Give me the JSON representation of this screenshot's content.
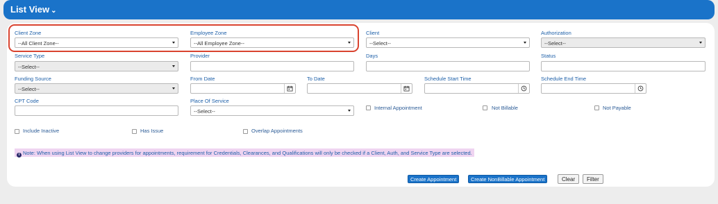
{
  "header": {
    "title": "List View"
  },
  "filters": {
    "client_zone": {
      "label": "Client Zone",
      "value": "--All Client Zone--"
    },
    "employee_zone": {
      "label": "Employee Zone",
      "value": "--All Employee Zone--"
    },
    "client": {
      "label": "Client",
      "value": "--Select--"
    },
    "authorization": {
      "label": "Authorization",
      "value": "--Select--"
    },
    "service_type": {
      "label": "Service Type",
      "value": "--Select--"
    },
    "provider": {
      "label": "Provider",
      "value": ""
    },
    "days": {
      "label": "Days",
      "value": ""
    },
    "status": {
      "label": "Status",
      "value": ""
    },
    "funding_source": {
      "label": "Funding Source",
      "value": "--Select--"
    },
    "from_date": {
      "label": "From Date",
      "value": ""
    },
    "to_date": {
      "label": "To Date",
      "value": ""
    },
    "schedule_start_time": {
      "label": "Schedule Start Time",
      "value": ""
    },
    "schedule_end_time": {
      "label": "Schedule End Time",
      "value": ""
    },
    "cpt_code": {
      "label": "CPT Code",
      "value": ""
    },
    "place_of_service": {
      "label": "Place Of Service",
      "value": "--Select--"
    }
  },
  "checkboxes": {
    "internal_appointment": "Internal Appointment",
    "not_billable": "Not Billable",
    "not_payable": "Not Payable",
    "include_inactive": "Include Inactive",
    "has_issue": "Has Issue",
    "overlap_appointments": "Overlap Appointments"
  },
  "note": "Note: When using List View to change providers for appointments, requirement for Credentials, Clearances, and Qualifications will only be checked if a Client, Auth, and Service Type are selected.",
  "buttons": {
    "create_appointment": "Create Appointment",
    "create_nonbillable": "Create NonBillable Appointment",
    "clear": "Clear",
    "filter": "Filter"
  }
}
